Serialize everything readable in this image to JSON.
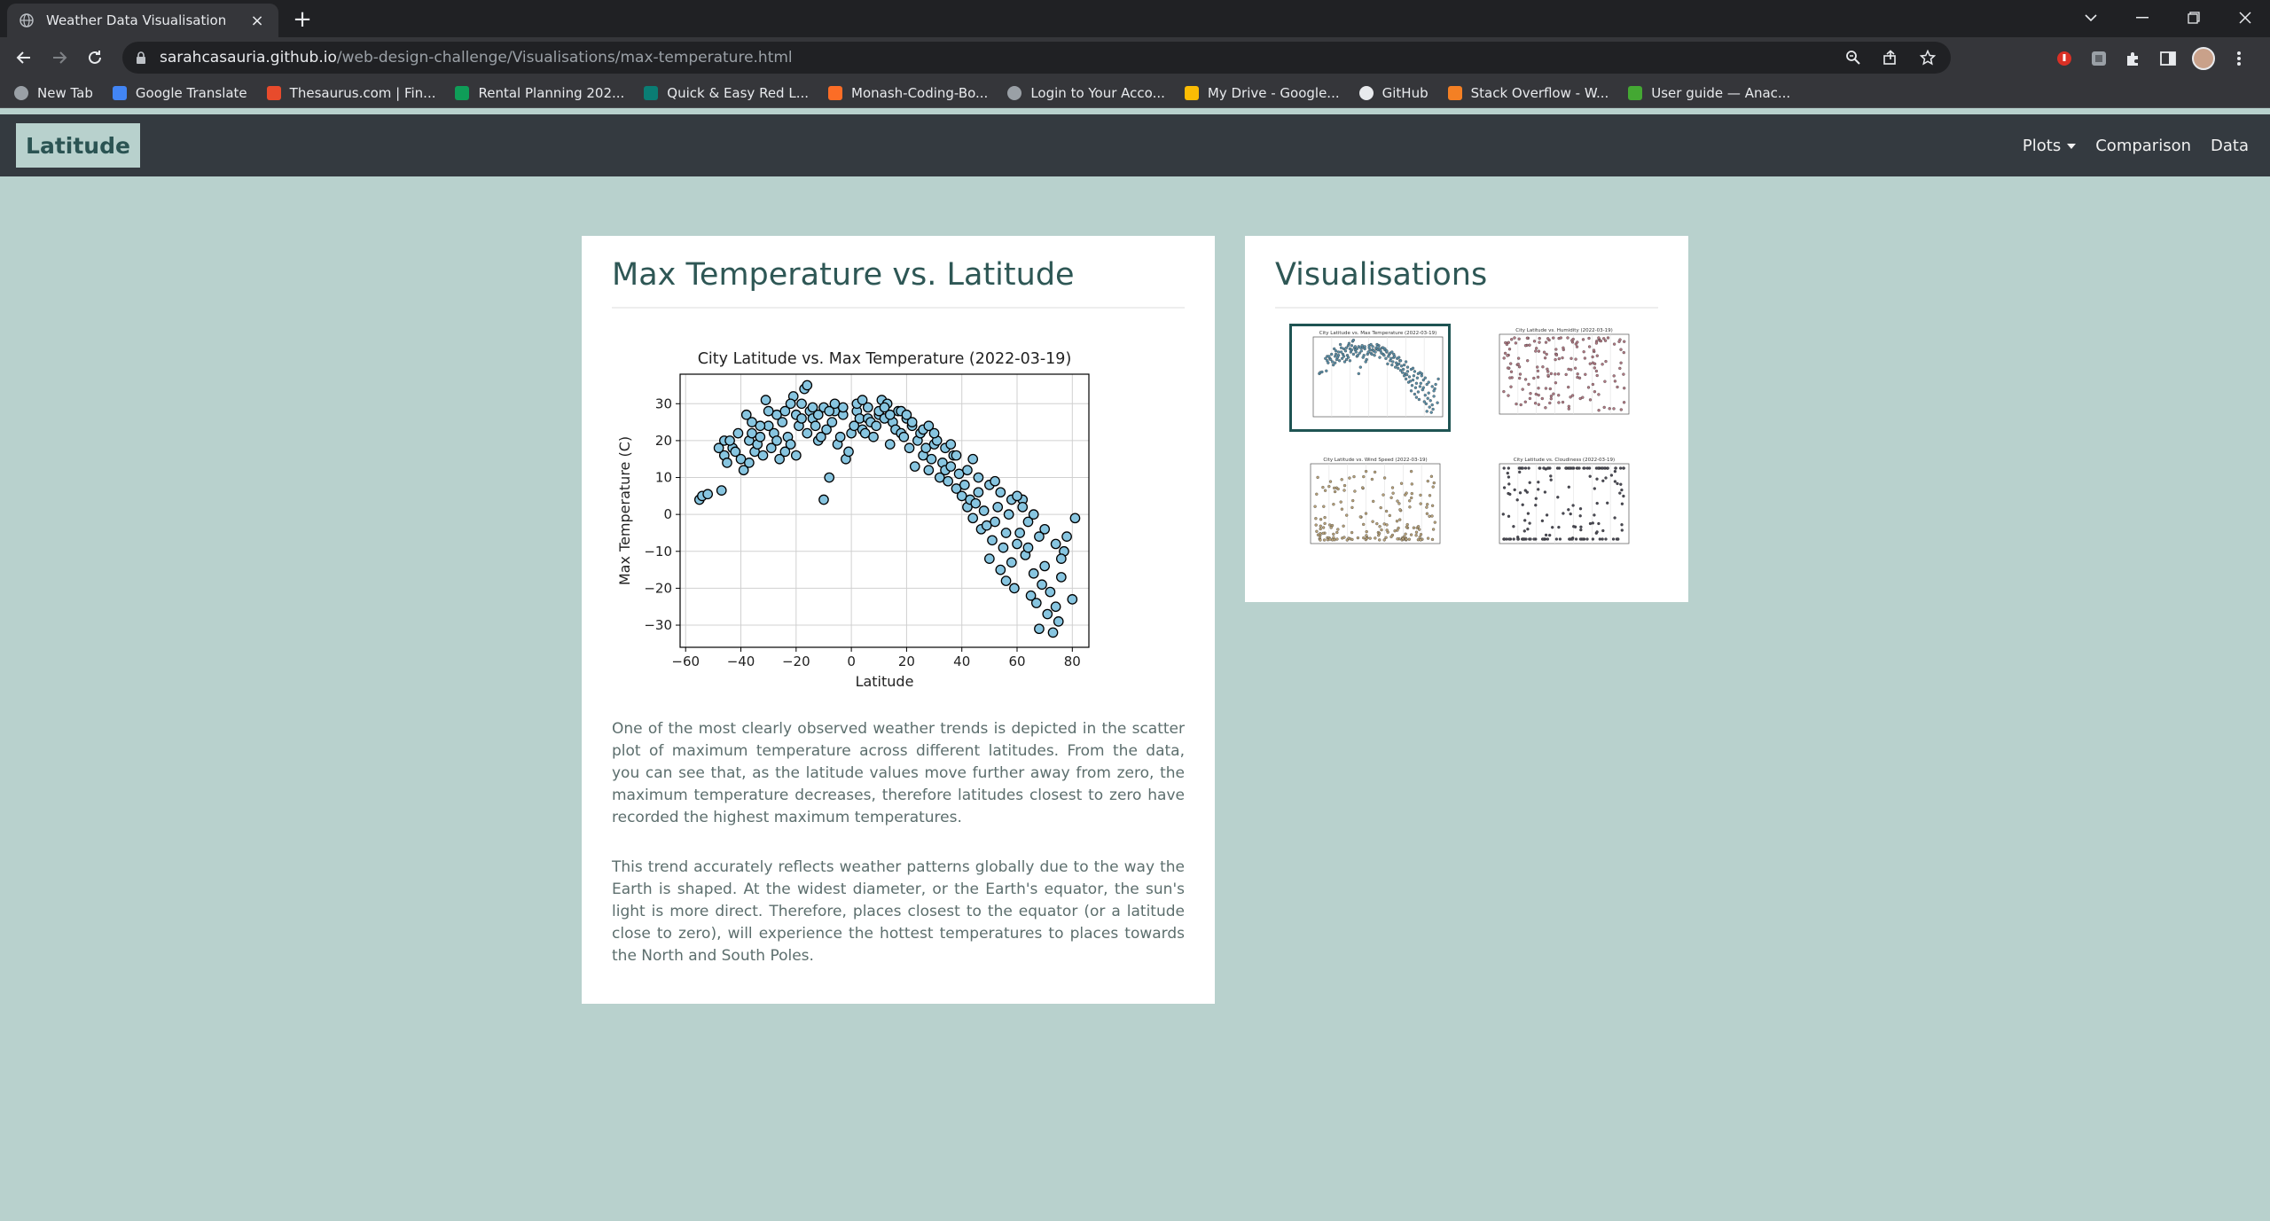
{
  "browser": {
    "tab_title": "Weather Data Visualisation",
    "url_host": "sarahcasauria.github.io",
    "url_path": "/web-design-challenge/Visualisations/max-temperature.html",
    "bookmarks": [
      {
        "label": "New Tab",
        "icon": "globe-icon",
        "color": "#9aa0a6"
      },
      {
        "label": "Google Translate",
        "icon": "translate-icon",
        "color": "#4285f4"
      },
      {
        "label": "Thesaurus.com | Fin...",
        "icon": "thesaurus-icon",
        "color": "#e84b2c"
      },
      {
        "label": "Rental Planning 202...",
        "icon": "sheets-icon",
        "color": "#0f9d58"
      },
      {
        "label": "Quick & Easy Red L...",
        "icon": "recipe-icon",
        "color": "#0a7d74"
      },
      {
        "label": "Monash-Coding-Bo...",
        "icon": "gitlab-icon",
        "color": "#fc6d26"
      },
      {
        "label": "Login to Your Acco...",
        "icon": "globe-icon",
        "color": "#9aa0a6"
      },
      {
        "label": "My Drive - Google...",
        "icon": "drive-icon",
        "color": "#fbbc04"
      },
      {
        "label": "GitHub",
        "icon": "github-icon",
        "color": "#e8eaed"
      },
      {
        "label": "Stack Overflow - W...",
        "icon": "stackoverflow-icon",
        "color": "#f48024"
      },
      {
        "label": "User guide — Anac...",
        "icon": "anaconda-icon",
        "color": "#44a833"
      }
    ]
  },
  "site": {
    "brand": "Latitude",
    "nav": {
      "plots": "Plots",
      "comparison": "Comparison",
      "data": "Data"
    }
  },
  "main": {
    "title": "Max Temperature vs. Latitude",
    "paragraph1": "One of the most clearly observed weather trends is depicted in the scatter plot of maximum temperature across different latitudes. From the data, you can see that, as the latitude values move further away from zero, the maximum temperature decreases, therefore latitudes closest to zero have recorded the highest maximum temperatures.",
    "paragraph2": "This trend accurately reflects weather patterns globally due to the way the Earth is shaped. At the widest diameter, or the Earth's equator, the sun's light is more direct. Therefore, places closest to the equator (or a latitude close to zero), will experience the hottest temperatures to places towards the North and South Poles."
  },
  "sidebar": {
    "title": "Visualisations",
    "thumbnails": [
      {
        "title": "City Latitude vs. Max Temperature (2022-03-19)",
        "color": "#5b8fa8",
        "active": true
      },
      {
        "title": "City Latitude vs. Humidity (2022-03-19)",
        "color": "#b07a84",
        "active": false
      },
      {
        "title": "City Latitude vs. Wind Speed (2022-03-19)",
        "color": "#b8a27a",
        "active": false
      },
      {
        "title": "City Latitude vs. Cloudiness (2022-03-19)",
        "color": "#4a4a55",
        "active": false
      }
    ]
  },
  "chart_data": {
    "type": "scatter",
    "title": "City Latitude vs. Max Temperature (2022-03-19)",
    "xlabel": "Latitude",
    "ylabel": "Max Temperature (C)",
    "xlim": [
      -62,
      86
    ],
    "ylim": [
      -36,
      38
    ],
    "xticks": [
      -60,
      -40,
      -20,
      0,
      20,
      40,
      60,
      80
    ],
    "yticks": [
      -30,
      -20,
      -10,
      0,
      10,
      20,
      30
    ],
    "grid": true,
    "marker_color": "#87c5e0",
    "edge_color": "#000000",
    "series": [
      {
        "points": [
          [
            -55,
            4
          ],
          [
            -54,
            5
          ],
          [
            -52,
            5.5
          ],
          [
            -47,
            6.5
          ],
          [
            -46,
            16
          ],
          [
            -46,
            20
          ],
          [
            -45,
            14
          ],
          [
            -43,
            18
          ],
          [
            -42,
            17
          ],
          [
            -40,
            15
          ],
          [
            -39,
            12
          ],
          [
            -38,
            27
          ],
          [
            -37,
            20
          ],
          [
            -37,
            14
          ],
          [
            -36,
            22
          ],
          [
            -35,
            17
          ],
          [
            -34,
            19
          ],
          [
            -33,
            21
          ],
          [
            -32,
            16
          ],
          [
            -31,
            31
          ],
          [
            -30,
            24
          ],
          [
            -29,
            18
          ],
          [
            -28,
            22
          ],
          [
            -27,
            20
          ],
          [
            -26,
            15
          ],
          [
            -25,
            25
          ],
          [
            -24,
            17
          ],
          [
            -23,
            21
          ],
          [
            -22,
            19
          ],
          [
            -21,
            32
          ],
          [
            -20,
            27
          ],
          [
            -20,
            16
          ],
          [
            -19,
            24
          ],
          [
            -18,
            26
          ],
          [
            -17,
            34
          ],
          [
            -16,
            35
          ],
          [
            -16,
            22
          ],
          [
            -15,
            28
          ],
          [
            -14,
            26
          ],
          [
            -13,
            24
          ],
          [
            -12,
            20
          ],
          [
            -11,
            21
          ],
          [
            -10,
            4
          ],
          [
            -10,
            29
          ],
          [
            -9,
            23
          ],
          [
            -8,
            10
          ],
          [
            -7,
            25
          ],
          [
            -6,
            28
          ],
          [
            -5,
            19
          ],
          [
            -4,
            21
          ],
          [
            -3,
            27
          ],
          [
            -2,
            15
          ],
          [
            -1,
            17
          ],
          [
            0,
            22
          ],
          [
            1,
            24
          ],
          [
            2,
            28
          ],
          [
            3,
            26
          ],
          [
            4,
            23
          ],
          [
            5,
            22
          ],
          [
            6,
            26
          ],
          [
            7,
            25
          ],
          [
            8,
            21
          ],
          [
            9,
            24
          ],
          [
            10,
            27
          ],
          [
            11,
            31
          ],
          [
            12,
            26
          ],
          [
            13,
            30
          ],
          [
            14,
            19
          ],
          [
            15,
            25
          ],
          [
            16,
            23
          ],
          [
            17,
            28
          ],
          [
            18,
            22
          ],
          [
            19,
            21
          ],
          [
            20,
            26
          ],
          [
            21,
            18
          ],
          [
            22,
            24
          ],
          [
            23,
            13
          ],
          [
            24,
            20
          ],
          [
            25,
            22
          ],
          [
            26,
            16
          ],
          [
            27,
            18
          ],
          [
            28,
            12
          ],
          [
            29,
            15
          ],
          [
            30,
            19
          ],
          [
            31,
            20
          ],
          [
            32,
            10
          ],
          [
            33,
            14
          ],
          [
            34,
            12
          ],
          [
            35,
            9
          ],
          [
            36,
            13
          ],
          [
            37,
            16
          ],
          [
            38,
            7
          ],
          [
            39,
            11
          ],
          [
            40,
            5
          ],
          [
            41,
            8
          ],
          [
            42,
            2
          ],
          [
            43,
            4
          ],
          [
            44,
            -1
          ],
          [
            45,
            3
          ],
          [
            46,
            6
          ],
          [
            47,
            -4
          ],
          [
            48,
            1
          ],
          [
            49,
            -3
          ],
          [
            50,
            -12
          ],
          [
            51,
            -7
          ],
          [
            52,
            -2
          ],
          [
            53,
            2
          ],
          [
            54,
            -15
          ],
          [
            55,
            -9
          ],
          [
            56,
            -18
          ],
          [
            57,
            0
          ],
          [
            58,
            -13
          ],
          [
            59,
            -20
          ],
          [
            60,
            -8
          ],
          [
            61,
            -5
          ],
          [
            62,
            4
          ],
          [
            63,
            -11
          ],
          [
            64,
            -2
          ],
          [
            65,
            -22
          ],
          [
            66,
            -16
          ],
          [
            67,
            -24
          ],
          [
            68,
            -31
          ],
          [
            69,
            -19
          ],
          [
            70,
            -14
          ],
          [
            71,
            -27
          ],
          [
            72,
            -21
          ],
          [
            73,
            -32
          ],
          [
            74,
            -25
          ],
          [
            75,
            -29
          ],
          [
            76,
            -17
          ],
          [
            77,
            -10
          ],
          [
            78,
            -6
          ],
          [
            80,
            -23
          ],
          [
            81,
            -1
          ],
          [
            -48,
            18
          ],
          [
            -44,
            20
          ],
          [
            -41,
            22
          ],
          [
            -33,
            24
          ],
          [
            -27,
            27
          ],
          [
            -24,
            28
          ],
          [
            -18,
            30
          ],
          [
            -12,
            27
          ],
          [
            -8,
            28
          ],
          [
            -3,
            29
          ],
          [
            2,
            30
          ],
          [
            6,
            29
          ],
          [
            10,
            28
          ],
          [
            14,
            27
          ],
          [
            18,
            28
          ],
          [
            22,
            25
          ],
          [
            26,
            23
          ],
          [
            30,
            22
          ],
          [
            34,
            18
          ],
          [
            38,
            16
          ],
          [
            42,
            12
          ],
          [
            46,
            10
          ],
          [
            50,
            8
          ],
          [
            54,
            6
          ],
          [
            58,
            4
          ],
          [
            62,
            2
          ],
          [
            66,
            0
          ],
          [
            70,
            -4
          ],
          [
            74,
            -8
          ],
          [
            -36,
            25
          ],
          [
            -30,
            28
          ],
          [
            -22,
            30
          ],
          [
            -14,
            29
          ],
          [
            -6,
            30
          ],
          [
            4,
            31
          ],
          [
            12,
            29
          ],
          [
            20,
            27
          ],
          [
            28,
            24
          ],
          [
            36,
            19
          ],
          [
            44,
            15
          ],
          [
            52,
            9
          ],
          [
            60,
            5
          ],
          [
            68,
            -6
          ],
          [
            76,
            -12
          ],
          [
            56,
            -5
          ],
          [
            64,
            -9
          ]
        ]
      }
    ]
  }
}
